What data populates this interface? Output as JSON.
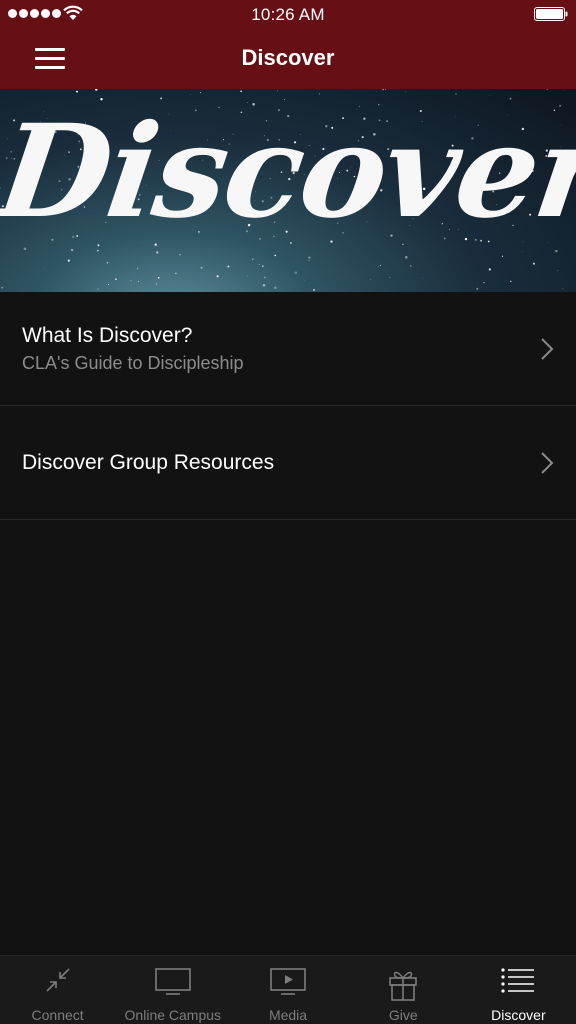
{
  "status_bar": {
    "time": "10:26 AM",
    "icons": [
      "signal-dots-icon",
      "wifi-icon",
      "battery-icon"
    ]
  },
  "header": {
    "title": "Discover",
    "menu_icon": "hamburger-menu-icon",
    "color": "#661016"
  },
  "hero": {
    "text": "Discover"
  },
  "list": {
    "items": [
      {
        "title": "What Is Discover?",
        "subtitle": "CLA's Guide to Discipleship",
        "icon": "chevron-right-icon"
      },
      {
        "title": "Discover Group Resources",
        "icon": "chevron-right-icon"
      }
    ]
  },
  "tab_bar": {
    "tabs": [
      {
        "label": "Connect",
        "icon": "connect-arrows-icon"
      },
      {
        "label": "Online Campus",
        "icon": "monitor-icon"
      },
      {
        "label": "Media",
        "icon": "play-screen-icon"
      },
      {
        "label": "Give",
        "icon": "gift-icon"
      },
      {
        "label": "Discover",
        "icon": "list-icon",
        "active": true
      }
    ],
    "active_color": "#ffffff",
    "inactive_color": "#7d7d7d"
  }
}
